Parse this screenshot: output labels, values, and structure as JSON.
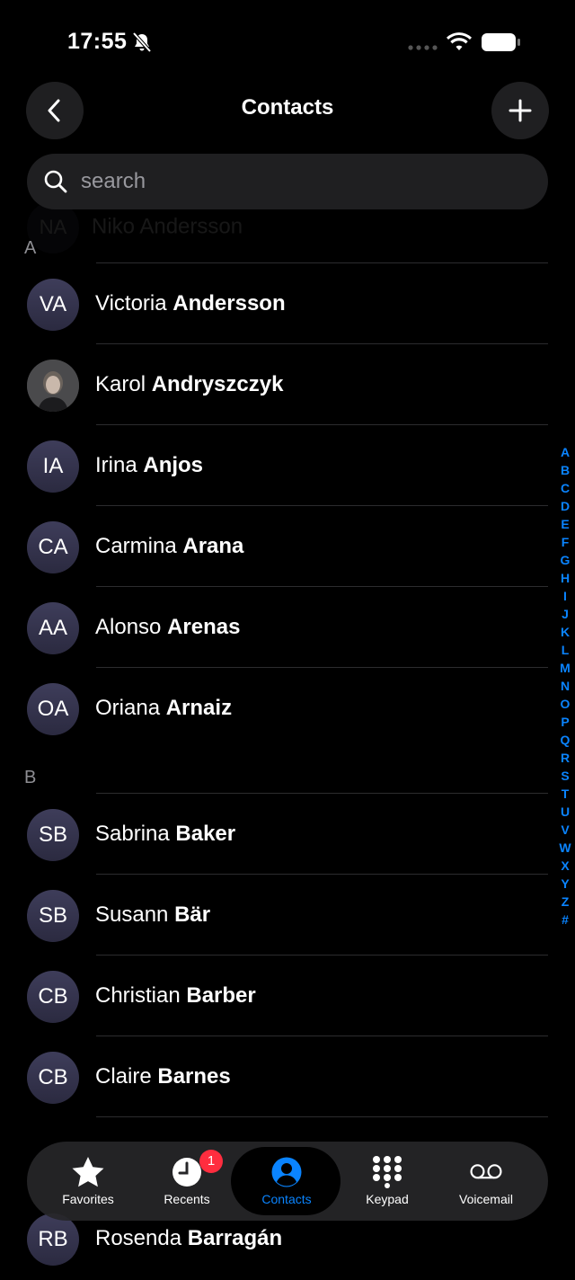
{
  "status": {
    "time": "17:55"
  },
  "header": {
    "title": "Contacts"
  },
  "search": {
    "placeholder": "search"
  },
  "ghost_rows": [
    "Niko Andersson"
  ],
  "sections": [
    {
      "letter": "A",
      "contacts": [
        {
          "initials": "VA",
          "first": "Victoria",
          "last": "Andersson",
          "photo": false
        },
        {
          "initials": "",
          "first": "Karol",
          "last": "Andryszczyk",
          "photo": true
        },
        {
          "initials": "IA",
          "first": "Irina",
          "last": "Anjos",
          "photo": false
        },
        {
          "initials": "CA",
          "first": "Carmina",
          "last": "Arana",
          "photo": false
        },
        {
          "initials": "AA",
          "first": "Alonso",
          "last": "Arenas",
          "photo": false
        },
        {
          "initials": "OA",
          "first": "Oriana",
          "last": "Arnaiz",
          "photo": false
        }
      ]
    },
    {
      "letter": "B",
      "contacts": [
        {
          "initials": "SB",
          "first": "Sabrina",
          "last": "Baker",
          "photo": false
        },
        {
          "initials": "SB",
          "first": "Susann",
          "last": "Bär",
          "photo": false
        },
        {
          "initials": "CB",
          "first": "Christian",
          "last": "Barber",
          "photo": false
        },
        {
          "initials": "CB",
          "first": "Claire",
          "last": "Barnes",
          "photo": false
        },
        {
          "initials": "RB",
          "first": "Rosenda",
          "last": "Barragán",
          "photo": false
        }
      ]
    }
  ],
  "index_letters": [
    "A",
    "B",
    "C",
    "D",
    "E",
    "F",
    "G",
    "H",
    "I",
    "J",
    "K",
    "L",
    "M",
    "N",
    "O",
    "P",
    "Q",
    "R",
    "S",
    "T",
    "U",
    "V",
    "W",
    "X",
    "Y",
    "Z",
    "#"
  ],
  "tabs": [
    {
      "label": "Favorites",
      "icon": "star-icon"
    },
    {
      "label": "Recents",
      "icon": "clock-icon",
      "badge": "1"
    },
    {
      "label": "Contacts",
      "icon": "person-circle-icon",
      "active": true
    },
    {
      "label": "Keypad",
      "icon": "keypad-icon"
    },
    {
      "label": "Voicemail",
      "icon": "voicemail-icon"
    }
  ],
  "colors": {
    "accent": "#0a84ff",
    "badge": "#ff2d3f",
    "avatar": "#35344d",
    "background": "#000000"
  }
}
